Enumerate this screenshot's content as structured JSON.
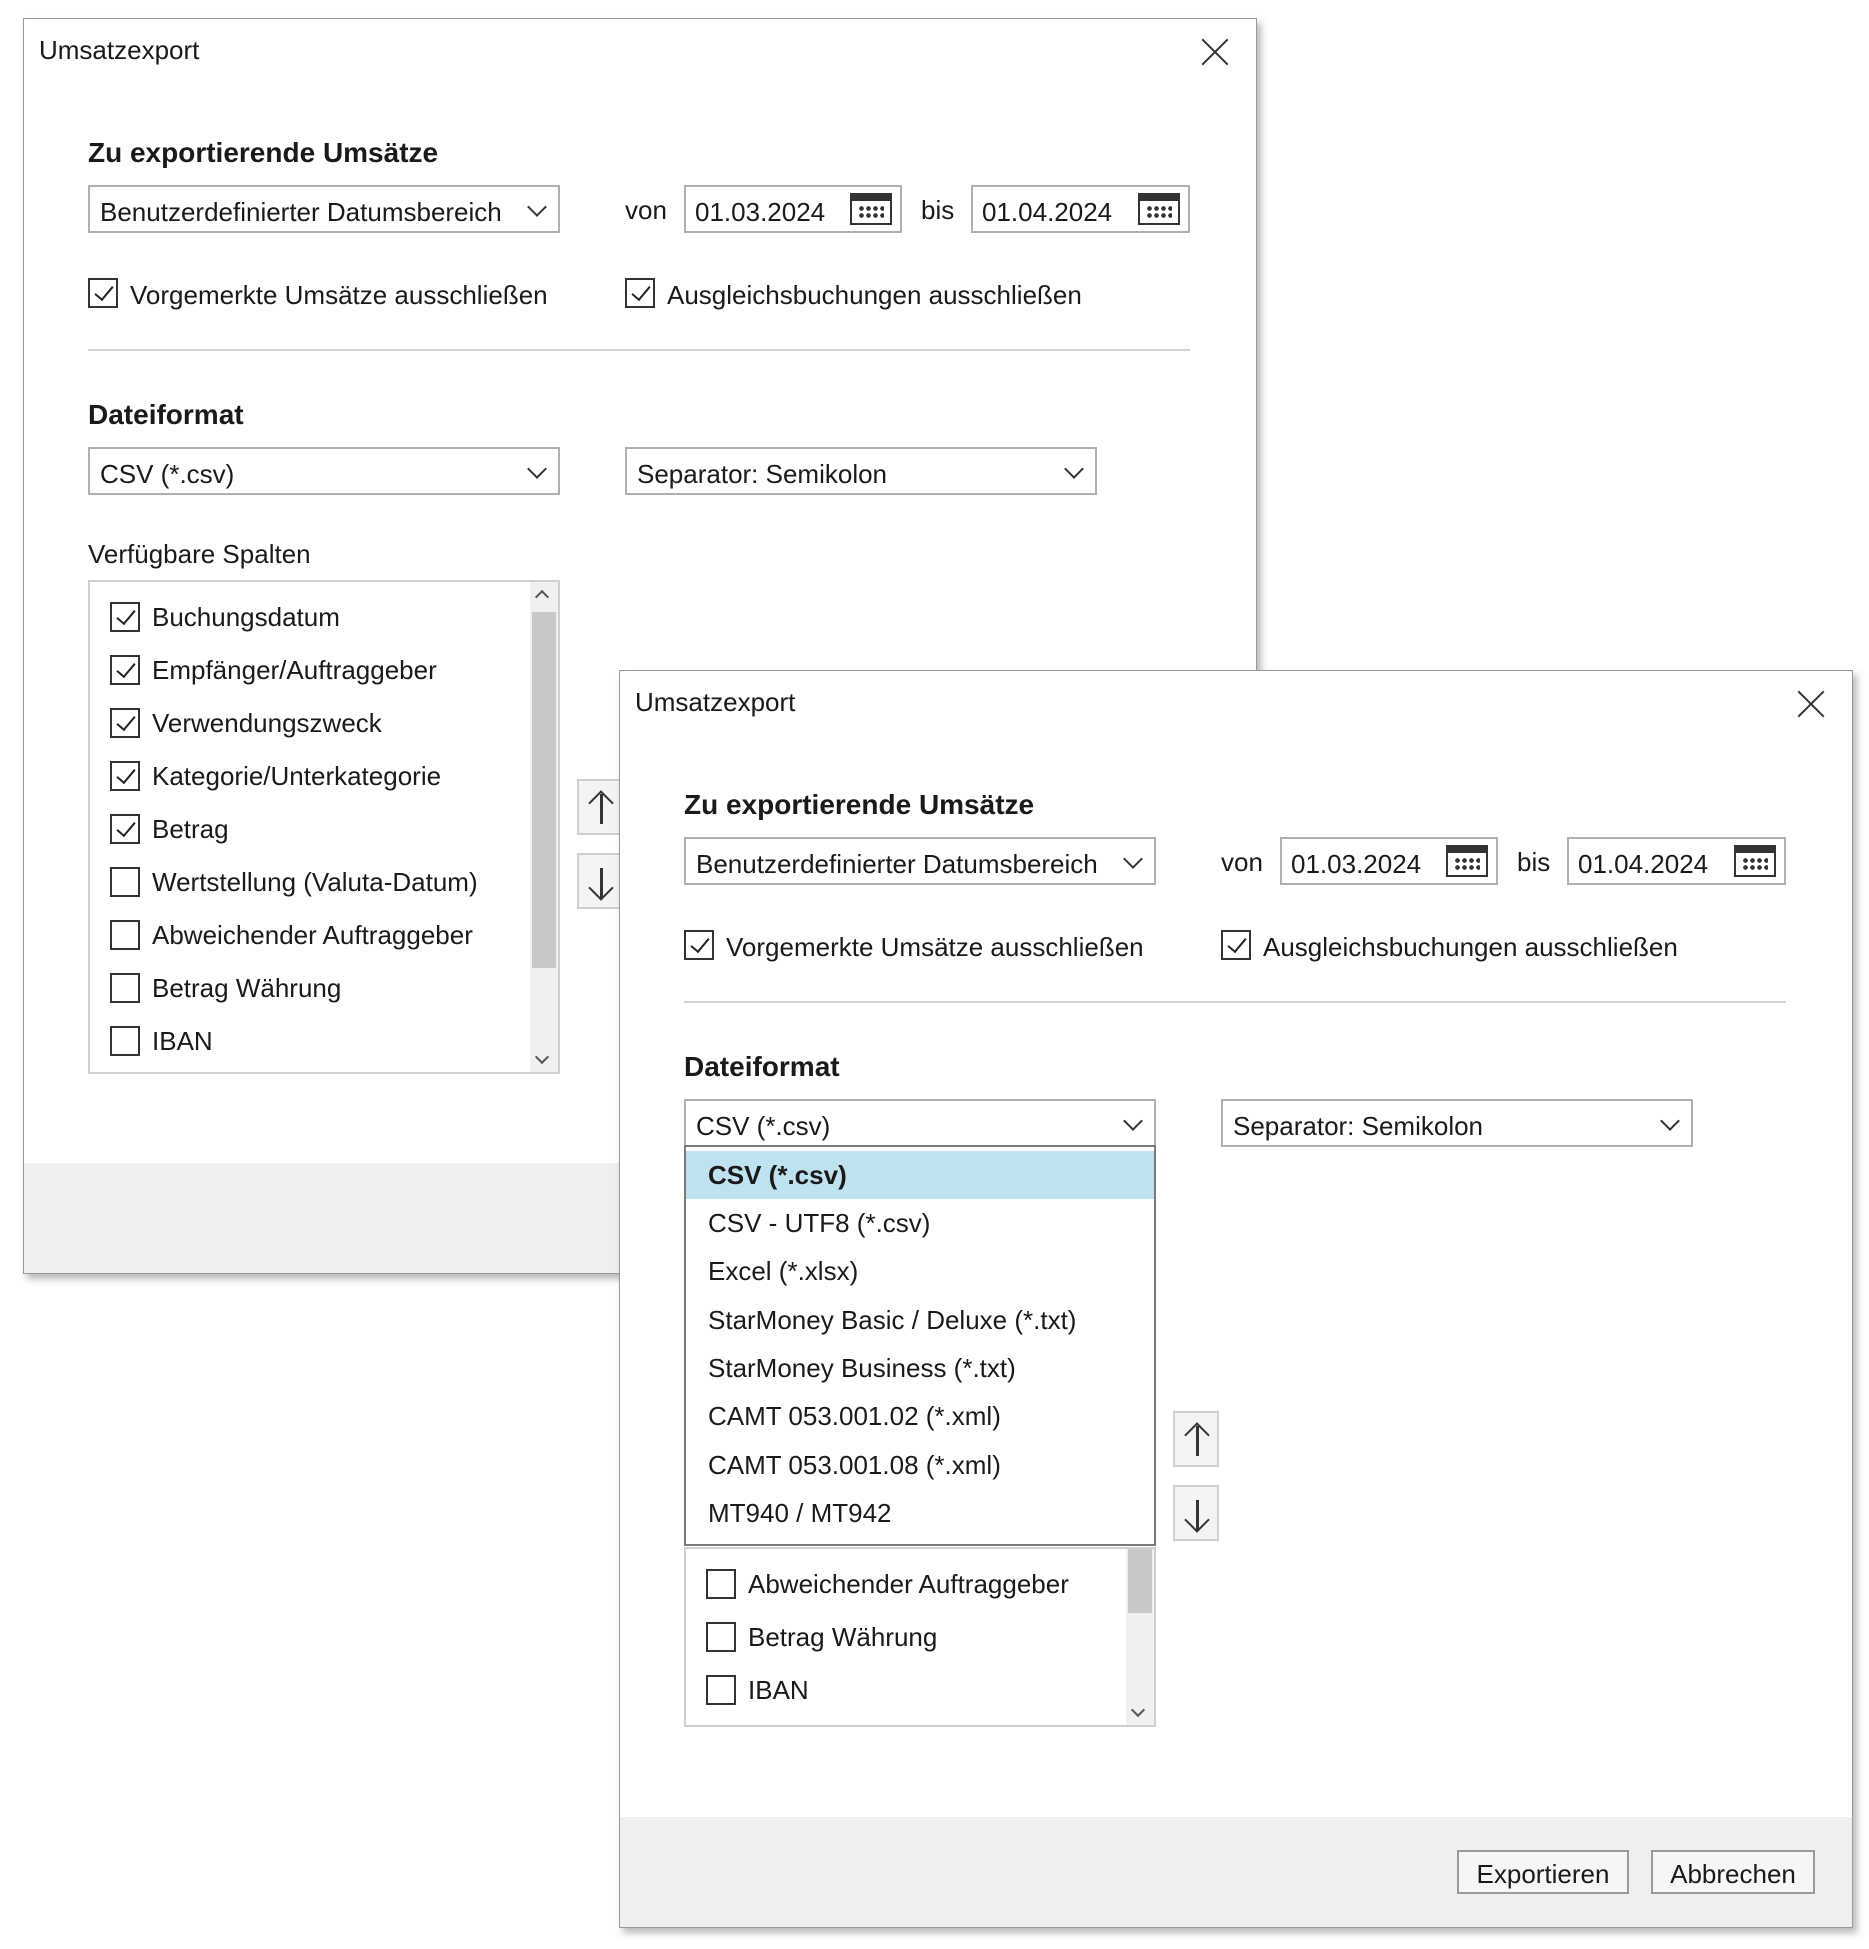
{
  "back": {
    "title": "Umsatzexport",
    "section_export": "Zu exportierende Umsätze",
    "range_value": "Benutzerdefinierter Datumsbereich",
    "von_label": "von",
    "von_value": "01.03.2024",
    "bis_label": "bis",
    "bis_value": "01.04.2024",
    "exclude_pending": "Vorgemerkte Umsätze ausschließen",
    "exclude_balancing": "Ausgleichsbuchungen ausschließen",
    "section_format": "Dateiformat",
    "format_value": "CSV (*.csv)",
    "separator_value": "Separator: Semikolon",
    "columns_label": "Verfügbare Spalten",
    "columns": [
      {
        "label": "Buchungsdatum",
        "checked": true
      },
      {
        "label": "Empfänger/Auftraggeber",
        "checked": true
      },
      {
        "label": "Verwendungszweck",
        "checked": true
      },
      {
        "label": "Kategorie/Unterkategorie",
        "checked": true
      },
      {
        "label": "Betrag",
        "checked": true
      },
      {
        "label": "Wertstellung (Valuta-Datum)",
        "checked": false
      },
      {
        "label": "Abweichender Auftraggeber",
        "checked": false
      },
      {
        "label": "Betrag Währung",
        "checked": false
      },
      {
        "label": "IBAN",
        "checked": false
      }
    ]
  },
  "front": {
    "title": "Umsatzexport",
    "section_export": "Zu exportierende Umsätze",
    "range_value": "Benutzerdefinierter Datumsbereich",
    "von_label": "von",
    "von_value": "01.03.2024",
    "bis_label": "bis",
    "bis_value": "01.04.2024",
    "exclude_pending": "Vorgemerkte Umsätze ausschließen",
    "exclude_balancing": "Ausgleichsbuchungen ausschließen",
    "section_format": "Dateiformat",
    "format_value": "CSV (*.csv)",
    "separator_value": "Separator: Semikolon",
    "format_options": [
      "CSV (*.csv)",
      "CSV - UTF8 (*.csv)",
      "Excel (*.xlsx)",
      "StarMoney Basic / Deluxe (*.txt)",
      "StarMoney Business (*.txt)",
      "CAMT 053.001.02  (*.xml)",
      "CAMT 053.001.08  (*.xml)",
      "MT940 / MT942"
    ],
    "selected_option_index": 0,
    "visible_columns": [
      {
        "label": "Abweichender Auftraggeber",
        "checked": false
      },
      {
        "label": "Betrag Währung",
        "checked": false
      },
      {
        "label": "IBAN",
        "checked": false
      }
    ],
    "export_button": "Exportieren",
    "cancel_button": "Abbrechen"
  }
}
